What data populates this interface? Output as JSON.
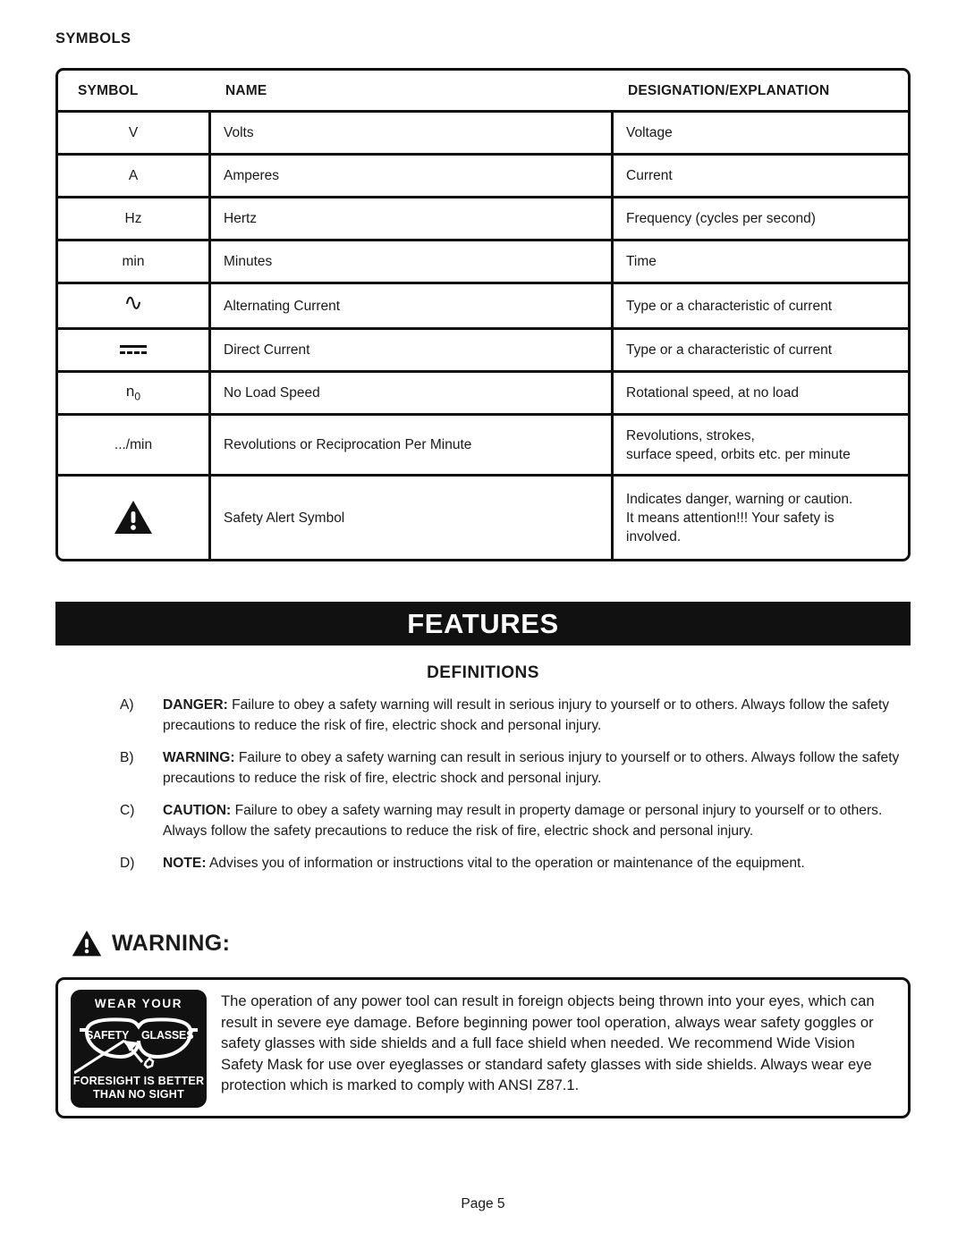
{
  "section_heading": "SYMBOLS",
  "symbols_table": {
    "columns": [
      "SYMBOL",
      "NAME",
      "DESIGNATION/EXPLANATION"
    ],
    "rows": [
      {
        "symbol": "V",
        "symbol_kind": "text",
        "name": "Volts",
        "designation": [
          "Voltage"
        ]
      },
      {
        "symbol": "A",
        "symbol_kind": "text",
        "name": "Amperes",
        "designation": [
          "Current"
        ]
      },
      {
        "symbol": "Hz",
        "symbol_kind": "text",
        "name": "Hertz",
        "designation": [
          "Frequency (cycles per second)"
        ]
      },
      {
        "symbol": "min",
        "symbol_kind": "text",
        "name": "Minutes",
        "designation": [
          "Time"
        ]
      },
      {
        "symbol": "∿",
        "symbol_kind": "alternating-current-icon",
        "name": "Alternating Current",
        "designation": [
          "Type or a characteristic of current"
        ]
      },
      {
        "symbol": "⎓",
        "symbol_kind": "direct-current-icon",
        "name": "Direct Current",
        "designation": [
          "Type or a characteristic of current"
        ]
      },
      {
        "symbol": "n0",
        "symbol_kind": "no-load-speed-icon",
        "name": "No Load Speed",
        "designation": [
          "Rotational speed, at no load"
        ]
      },
      {
        "symbol": ".../min",
        "symbol_kind": "text",
        "name": "Revolutions or Reciprocation Per Minute",
        "designation": [
          "Revolutions, strokes,",
          "surface speed, orbits etc. per minute"
        ]
      },
      {
        "symbol": "⚠",
        "symbol_kind": "safety-alert-icon",
        "name": "Safety Alert Symbol",
        "designation": [
          "Indicates danger, warning or caution.",
          "It means attention!!! Your safety is",
          "involved."
        ]
      }
    ]
  },
  "features_banner": "FEATURES",
  "definitions": {
    "heading": "DEFINITIONS",
    "items": [
      {
        "marker": "A)",
        "term": "DANGER:",
        "text": " Failure to obey a safety warning will result in serious injury to yourself or to others. Always follow the safety precautions to reduce the risk of fire, electric shock and personal injury."
      },
      {
        "marker": "B)",
        "term": "WARNING:",
        "text": " Failure to obey a safety warning can result in serious injury to yourself or to others. Always follow the safety precautions to reduce the risk of fire, electric shock and personal injury."
      },
      {
        "marker": "C)",
        "term": "CAUTION:",
        "text": " Failure to obey a safety warning may result in property damage or personal injury to yourself or to others. Always follow the safety precautions to reduce the risk of fire, electric shock and personal injury."
      },
      {
        "marker": "D)",
        "term": "NOTE:",
        "text": "  Advises you of information or instructions vital to the operation or maintenance of the equipment."
      }
    ]
  },
  "warning": {
    "heading": "WARNING:",
    "graphic": {
      "top_text": "WEAR YOUR",
      "lens_left": "SAFETY",
      "lens_right": "GLASSES",
      "bottom_line1": "FORESIGHT IS BETTER",
      "bottom_line2": "THAN NO SIGHT"
    },
    "body": "The operation of any power tool can result in foreign objects being thrown into your eyes, which can result in severe eye damage. Before beginning power tool operation, always wear safety goggles or safety glasses with side shields and a full face shield when needed. We recommend Wide Vision Safety Mask for use over eyeglasses or standard safety glasses with side shields. Always wear eye protection which is marked to comply with ANSI Z87.1."
  },
  "footer": "Page 5",
  "colors": {
    "ink": "#1a1a1a",
    "rule": "#111111",
    "banner_bg": "#111111",
    "banner_fg": "#ffffff",
    "paper": "#ffffff"
  }
}
